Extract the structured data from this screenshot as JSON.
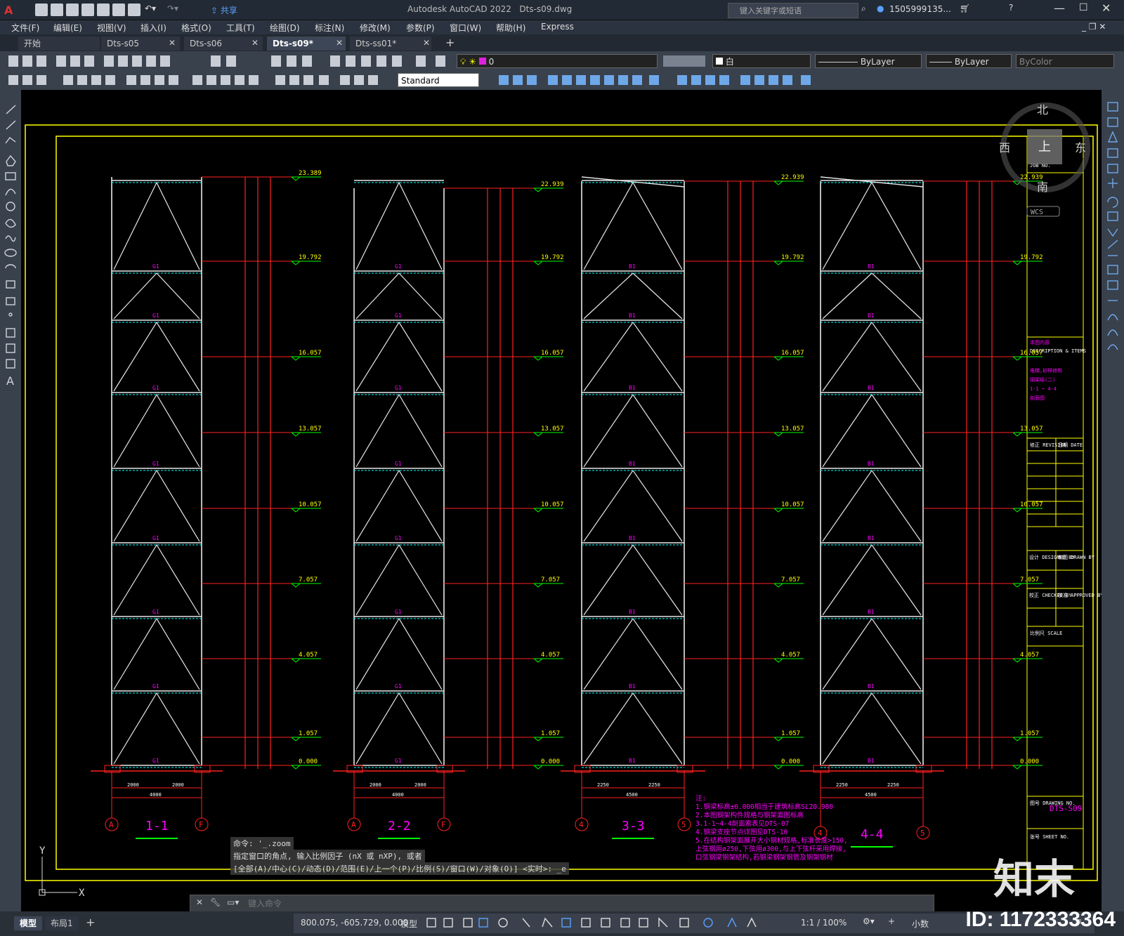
{
  "titlebar": {
    "app_title": "Autodesk AutoCAD 2022",
    "file_title": "Dts-s09.dwg",
    "search_placeholder": "键入关键字或短语",
    "user": "1505999135...",
    "share_label": "共享"
  },
  "menu": [
    "文件(F)",
    "编辑(E)",
    "视图(V)",
    "插入(I)",
    "格式(O)",
    "工具(T)",
    "绘图(D)",
    "标注(N)",
    "修改(M)",
    "参数(P)",
    "窗口(W)",
    "帮助(H)",
    "Express"
  ],
  "tabs": [
    "开始",
    "Dts-s05",
    "Dts-s06",
    "Dts-s09*",
    "Dts-ss01*"
  ],
  "active_tab": "Dts-s09*",
  "toolbar": {
    "layer_value": "0",
    "color_value": "白",
    "linetype_value": "ByLayer",
    "lineweight_value": "ByLayer",
    "plotstyle_value": "ByColor",
    "textstyle_value": "Standard"
  },
  "viewcube": {
    "north": "北",
    "south": "南",
    "east": "东",
    "west": "西",
    "top": "上",
    "wcs": "WCS"
  },
  "command": {
    "history1": "命令: '_.zoom",
    "history2": "指定窗口的角点, 输入比例因子 (nX 或 nXP), 或者",
    "history3": "[全部(A)/中心(C)/动态(D)/范围(E)/上一个(P)/比例(S)/窗口(W)/对象(O)] <实时>: _e",
    "placeholder": "键入命令"
  },
  "layout_tabs": [
    "模型",
    "布局1"
  ],
  "status": {
    "coords": "800.075, -605.729, 0.000",
    "model": "模型",
    "scale": "1:1 / 100%",
    "units": "小数"
  },
  "drawing": {
    "sections": [
      {
        "label": "1-1",
        "axis_left": "A",
        "axis_right": "F",
        "dim_total": "4000",
        "dim_half": "2000"
      },
      {
        "label": "2-2",
        "axis_left": "A",
        "axis_right": "F",
        "dim_total": "4000",
        "dim_half": "2000"
      },
      {
        "label": "3-3",
        "axis_left": "4",
        "axis_right": "5",
        "dim_total": "4500",
        "dim_half": "2250"
      },
      {
        "label": "4-4",
        "axis_left": "4",
        "axis_right": "5",
        "dim_total": "4500",
        "dim_half": "2250"
      }
    ],
    "levels_s1": [
      "23.389",
      "19.792",
      "16.057",
      "13.057",
      "10.057",
      "7.057",
      "4.057",
      "1.057",
      "0.000"
    ],
    "levels_s2": [
      "22.939",
      "19.792",
      "16.057",
      "13.057",
      "10.057",
      "7.057",
      "4.057",
      "1.057",
      "0.000"
    ],
    "title_block": {
      "job_no": "JOB NO.",
      "desc": "本图内容",
      "desc_en": "DESCRIPTION & ITEMS",
      "desc_text1": "电梯,砂样修剪",
      "desc_text2": "钢架结(二)",
      "desc_text3": "1-1 ~ 4-4",
      "desc_text4": "剖面图",
      "revision": "修正 REVISION",
      "date": "日期 DATE",
      "designed": "设计 DESIGNED BY",
      "drawn": "制图 DRAWN BY",
      "checked": "校正 CHECKED BY",
      "approved": "核准 APPROVED BY",
      "scale": "比例尺 SCALE",
      "drawing_no_label": "图号 DRAWING NO.",
      "drawing_no": "DTS-S09",
      "sheet_no": "张号 SHEET NO."
    },
    "notes": [
      "注:",
      "1.钢梁标高±0.000相当于建筑标高SL20.980",
      "2.本图钢架构件规格与钢架面图标高",
      "3.1-1~4-4剖面索表见DTS-07",
      "4.钢梁支座节点详图见DTS-10",
      "5.在结构钢架面展开大小钢材规格,标准长度>150,",
      "  上弦钢用ø250,下弦用ø300,与上下弦杆采用焊接,",
      "  口弦钢梁钢架结构,若钢梁钢架钢管及钢架钢材"
    ]
  },
  "watermark": {
    "logo": "知末",
    "id": "ID: 1172333364"
  }
}
